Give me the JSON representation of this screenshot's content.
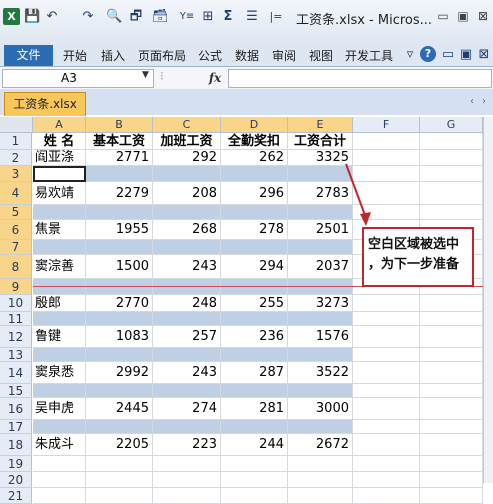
{
  "window": {
    "title": "工资条.xlsx - Micros...",
    "controls": [
      "▭",
      "▣",
      "⊠"
    ]
  },
  "quick_access": [
    "💾",
    "↶",
    "↷",
    "🔍",
    "🗗",
    "🗃",
    "Y≡",
    "⊞",
    "Σ",
    "☰",
    "|="
  ],
  "ribbon": {
    "file_label": "文件",
    "tabs": [
      "开始",
      "插入",
      "页面布局",
      "公式",
      "数据",
      "审阅",
      "视图",
      "开发工具"
    ]
  },
  "formula_bar": {
    "name_box": "A3",
    "fx": "fx",
    "value": ""
  },
  "workbook_tab": "工资条.xlsx",
  "columns": [
    "A",
    "B",
    "C",
    "D",
    "E",
    "F",
    "G"
  ],
  "rows": [
    "1",
    "2",
    "3",
    "4",
    "5",
    "6",
    "7",
    "8",
    "9",
    "10",
    "11",
    "12",
    "13",
    "14",
    "15",
    "16",
    "17",
    "18",
    "19",
    "20",
    "21"
  ],
  "table": {
    "headers": [
      "姓 名",
      "基本工资",
      "加班工资",
      "全勤奖扣",
      "工资合计"
    ],
    "records": [
      {
        "row": 2,
        "cells": [
          "阎亚涤",
          "2771",
          "292",
          "262",
          "3325"
        ]
      },
      {
        "row": 4,
        "cells": [
          "易欢靖",
          "2279",
          "208",
          "296",
          "2783"
        ]
      },
      {
        "row": 6,
        "cells": [
          "焦景",
          "1955",
          "268",
          "278",
          "2501"
        ]
      },
      {
        "row": 8,
        "cells": [
          "窦淙善",
          "1500",
          "243",
          "294",
          "2037"
        ]
      },
      {
        "row": 10,
        "cells": [
          "殷郎",
          "2770",
          "248",
          "255",
          "3273"
        ]
      },
      {
        "row": 12,
        "cells": [
          "鲁键",
          "1083",
          "257",
          "236",
          "1576"
        ]
      },
      {
        "row": 14,
        "cells": [
          "窦泉悉",
          "2992",
          "243",
          "287",
          "3522"
        ]
      },
      {
        "row": 16,
        "cells": [
          "吴申虎",
          "2445",
          "274",
          "281",
          "3000"
        ]
      },
      {
        "row": 18,
        "cells": [
          "朱成斗",
          "2205",
          "223",
          "244",
          "2672"
        ]
      }
    ]
  },
  "callout": {
    "line1": "空白区域被选中",
    "line2": "，为下一步准备"
  },
  "colors": {
    "selection_blue": "#bfcfe4",
    "callout_border": "#c0272d",
    "file_tab": "#2b6cb5",
    "workbook_tab": "#f9c65a"
  }
}
